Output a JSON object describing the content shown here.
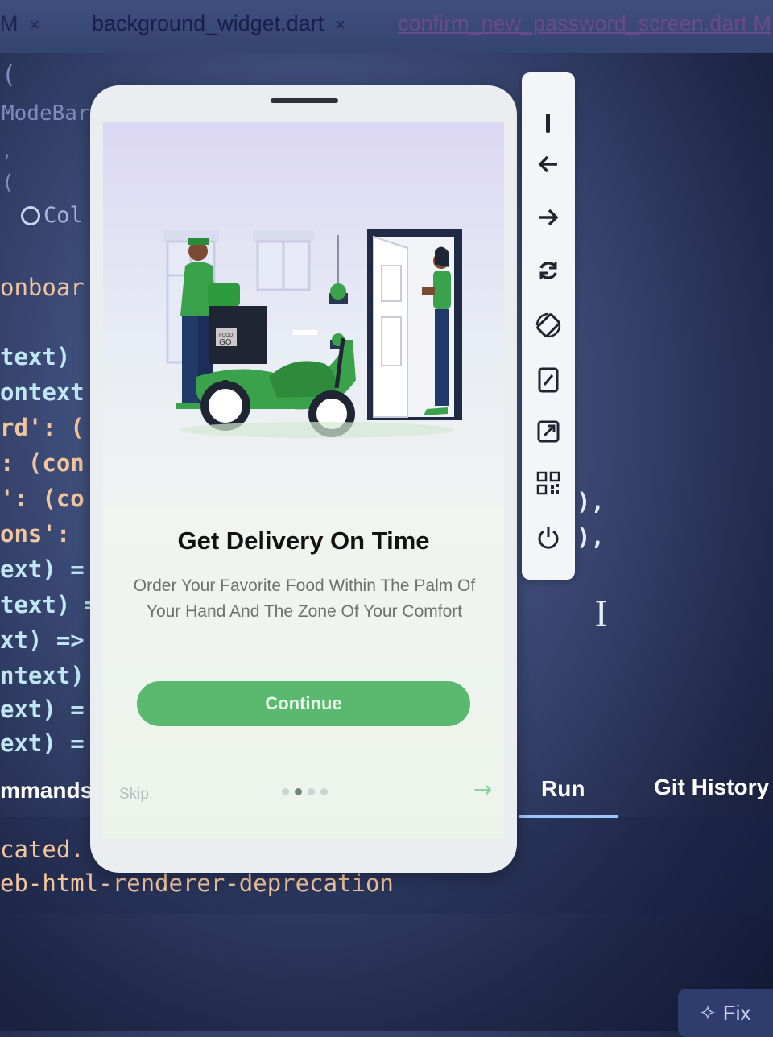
{
  "tabs": [
    {
      "label": "M",
      "close": "×"
    },
    {
      "label": "background_widget.dart",
      "close": "×"
    },
    {
      "label": "confirm_new_password_screen.dart M"
    }
  ],
  "code_lines": [
    {
      "text": "(",
      "cls": "c-dim"
    },
    {
      "text": "ModeBar",
      "cls": "c-dim"
    },
    {
      "text": ",",
      "cls": "c-dim"
    },
    {
      "text": "(",
      "cls": "c-dim"
    },
    {
      "text": "Col",
      "cls": "c-dim"
    },
    {
      "text": "onboar",
      "cls": "c-orange"
    },
    {
      "text": "text)",
      "cls": "c-teal"
    },
    {
      "text": "ontext",
      "cls": "c-teal"
    },
    {
      "text": "rd': (",
      "cls": "c-orange"
    },
    {
      "text": ": (con",
      "cls": "c-orange"
    },
    {
      "text": "': (co",
      "cls": "c-orange"
    },
    {
      "text": "ons':",
      "cls": "c-orange"
    },
    {
      "text": "ext) =",
      "cls": "c-teal"
    },
    {
      "text": "text) =",
      "cls": "c-teal"
    },
    {
      "text": "xt) =>",
      "cls": "c-teal"
    },
    {
      "text": "ntext)",
      "cls": "c-teal"
    },
    {
      "text": "ext) =",
      "cls": "c-teal"
    },
    {
      "text": "ext) =",
      "cls": "c-teal"
    }
  ],
  "code_suffix_1": "),",
  "code_suffix_2": "),",
  "panels": {
    "commands": "mmands",
    "run": "Run",
    "git_history": "Git History"
  },
  "terminal_lines": [
    "cated. S",
    "eb-html-renderer-deprecation"
  ],
  "fix_label": "Fix",
  "screen": {
    "title": "Get Delivery On Time",
    "description": "Order Your Favorite Food Within The Palm Of Your Hand And The Zone Of Your Comfort",
    "cta_label": "Continue",
    "skip_label": "Skip",
    "page_count": 4,
    "active_page": 2,
    "box_label_top": "FOOD",
    "box_label_main": "GO"
  },
  "toolbar": [
    "minimize-icon",
    "back-arrow-icon",
    "forward-arrow-icon",
    "refresh-icon",
    "rotate-device-icon",
    "screenshot-icon",
    "open-external-icon",
    "qr-code-icon",
    "power-icon"
  ],
  "colors": {
    "accent_green": "#5bb96f",
    "ide_bg": "#3b4a76"
  }
}
